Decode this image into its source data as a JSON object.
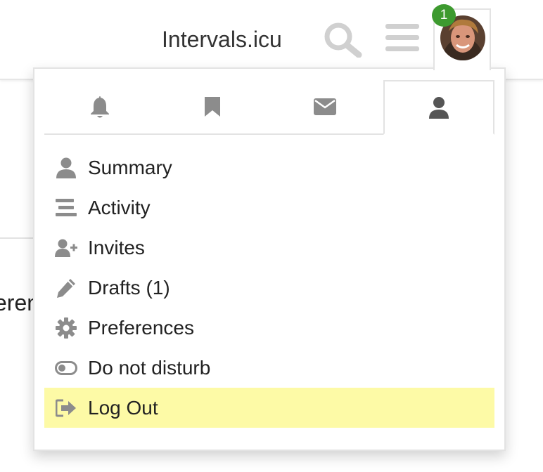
{
  "header": {
    "site_title": "Intervals.icu",
    "notification_count": "1",
    "icons": [
      "search-icon",
      "hamburger-menu-icon",
      "user-avatar"
    ]
  },
  "background": {
    "partial_text": "eren"
  },
  "dropdown": {
    "tabs": [
      {
        "icon": "bell-icon",
        "active": false
      },
      {
        "icon": "bookmark-icon",
        "active": false
      },
      {
        "icon": "envelope-icon",
        "active": false
      },
      {
        "icon": "user-icon",
        "active": true
      }
    ],
    "items": [
      {
        "label": "Summary",
        "icon": "user-icon"
      },
      {
        "label": "Activity",
        "icon": "activity-bars-icon"
      },
      {
        "label": "Invites",
        "icon": "user-plus-icon"
      },
      {
        "label": "Drafts (1)",
        "icon": "pencil-icon"
      },
      {
        "label": "Preferences",
        "icon": "gear-icon"
      },
      {
        "label": "Do not disturb",
        "icon": "toggle-off-icon"
      },
      {
        "label": "Log Out",
        "icon": "sign-out-icon",
        "highlighted": true
      }
    ]
  },
  "colors": {
    "badge": "#3d9a2f",
    "highlight": "#fdfaa6",
    "icon_gray": "#8c8c8c",
    "header_icon_gray": "#d0d0d0"
  }
}
